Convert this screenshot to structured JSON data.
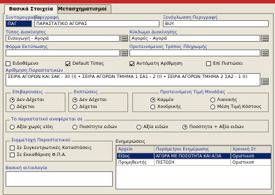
{
  "tabs": [
    {
      "label": "Βασικά Στοιχεία",
      "active": true
    },
    {
      "label": "Μετασχηματισμοί",
      "active": false
    }
  ],
  "fields": {
    "code_label": "Συντομογραφία",
    "code_value": "ΠΑΓ",
    "description_label": "Περιγραφή",
    "description_value": "ΠΑΡΑΣΤΑΤΙΚΟ ΑΓΟΡΑΣ",
    "foreign_label": "Ξενόγλωσση Περιγραφή",
    "foreign_value": "BUY",
    "type_label": "Τύπος Διακίνησης",
    "type_value": "Εισαγωγή - Αγορά",
    "cycle_label": "Κύκλωμα Διακίνησης",
    "cycle_value": "Αγορές - Αγορά",
    "tax_label": "Φόρμα Εκτύπωσης",
    "tax_value": "",
    "payment_label": "Προτεινόμενος Τρόπος Πληρωμής",
    "payment_value": "",
    "numbering_label": "Αρίθμηση Παραστατικών",
    "numbering_value": "ΣΕΙΡΑ ΑΓΟΡΩΝ ΚΑΙ ΣΑΚ - 30 (I) • ΣΕΙΡΑ ΑΓΟΡΩΝ ΤΜΗΜΑ 1 ΣΑ1 - 2 (I) • ΣΕΙΡΑ ΑΓΟΡΩΝ ΤΜΗΜΑ 2 ΣΑ2 - 1 (I)"
  },
  "checkboxes": [
    {
      "label": "Ειδοθέμενο",
      "checked": false
    },
    {
      "label": "Default Τύπος",
      "checked": true
    },
    {
      "label": "Αυτόματη Αρίθμηση",
      "checked": true
    },
    {
      "label": "Επί Πιστώσει",
      "checked": false
    }
  ],
  "groups": {
    "returns_title": "Επιβαρύνσεις",
    "returns_options": [
      "Δεν Δέχεται",
      "Δέχεται"
    ],
    "discounts_title": "Εκπτώσεις",
    "discounts_options": [
      "Δεν Δέχεται",
      "Δέχεται"
    ],
    "unit_title": "Προτεινόμενη Τιμή Μονάδας",
    "unit_options": [
      "Καμμία",
      "Λιανικής",
      "Χονδρικής",
      "Μέση Τιμή Κόστους"
    ],
    "refers_title": "Το παραστατικό αναφέρεται σε",
    "refers_options": [
      "Αξία χωρίς είδη",
      "Ποσότητα ειδών",
      "Αξία ειδών",
      "Ποσότητα + Αξία ειδών"
    ],
    "related_title": "Συμμετοχή Παραστατικού",
    "related_items": [
      "Σε Συγκεντρωτικές Καταστάσεις",
      "Σε Εκκαθάριση Φ.Π.Α."
    ],
    "base_label": "Βασική αιτιολογία"
  },
  "updates": {
    "title": "Ενημερώσεις",
    "columns": [
      "Αρχείο",
      "Παράμετροι Ενημέρωσης",
      "Χρονική Στ"
    ],
    "rows": [
      [
        "Είδος",
        "ΑΓΟΡΑ ΜΕ ΠΟΣΟΤΗΤΑ ΚΑΙ ΑΞΙΑ",
        "Οριστικοπ"
      ],
      [
        "Προμηθευτής",
        "ΠΙΣΤΩΣΗ",
        "Οριστικοπ"
      ]
    ]
  },
  "icons": {
    "lookup": "list-icon"
  },
  "colors": {
    "accent_bar": "#c62828",
    "label_blue": "#1b2f8e",
    "selection": "#0a246a"
  }
}
